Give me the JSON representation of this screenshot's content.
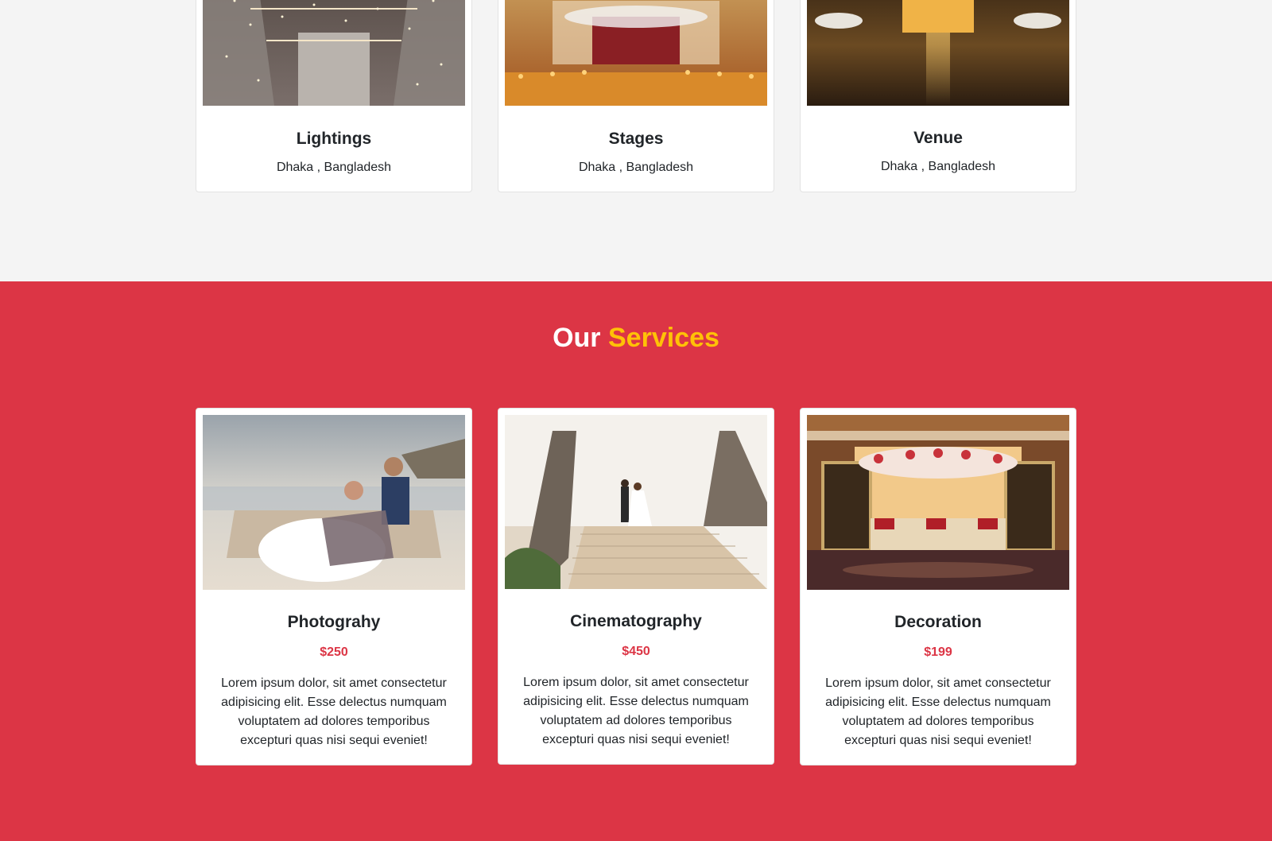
{
  "gallery": {
    "cards": [
      {
        "title": "Lightings",
        "location": "Dhaka , Bangladesh",
        "image": "barn-string-lights-photo"
      },
      {
        "title": "Stages",
        "location": "Dhaka , Bangladesh",
        "image": "wedding-stage-photo"
      },
      {
        "title": "Venue",
        "location": "Dhaka , Bangladesh",
        "image": "banquet-hall-photo"
      }
    ]
  },
  "services": {
    "heading_part1": "Our",
    "heading_part2": "Services",
    "cards": [
      {
        "title": "Photograhy",
        "price": "$250",
        "description": "Lorem ipsum dolor, sit amet consectetur adipisicing elit. Esse delectus numquam voluptatem ad dolores temporibus excepturi quas nisi sequi eveniet!",
        "image": "couple-on-beach-sofa-photo"
      },
      {
        "title": "Cinematography",
        "price": "$450",
        "description": "Lorem ipsum dolor, sit amet consectetur adipisicing elit. Esse delectus numquam voluptatem ad dolores temporibus excepturi quas nisi sequi eveniet!",
        "image": "couple-on-bridge-photo"
      },
      {
        "title": "Decoration",
        "price": "$199",
        "description": "Lorem ipsum dolor, sit amet consectetur adipisicing elit. Esse delectus numquam voluptatem ad dolores temporibus excepturi quas nisi sequi eveniet!",
        "image": "decorated-stage-photo"
      }
    ]
  },
  "colors": {
    "accent_red": "#dc3545",
    "accent_yellow": "#ffc107",
    "light_bg": "#f4f4f4"
  }
}
